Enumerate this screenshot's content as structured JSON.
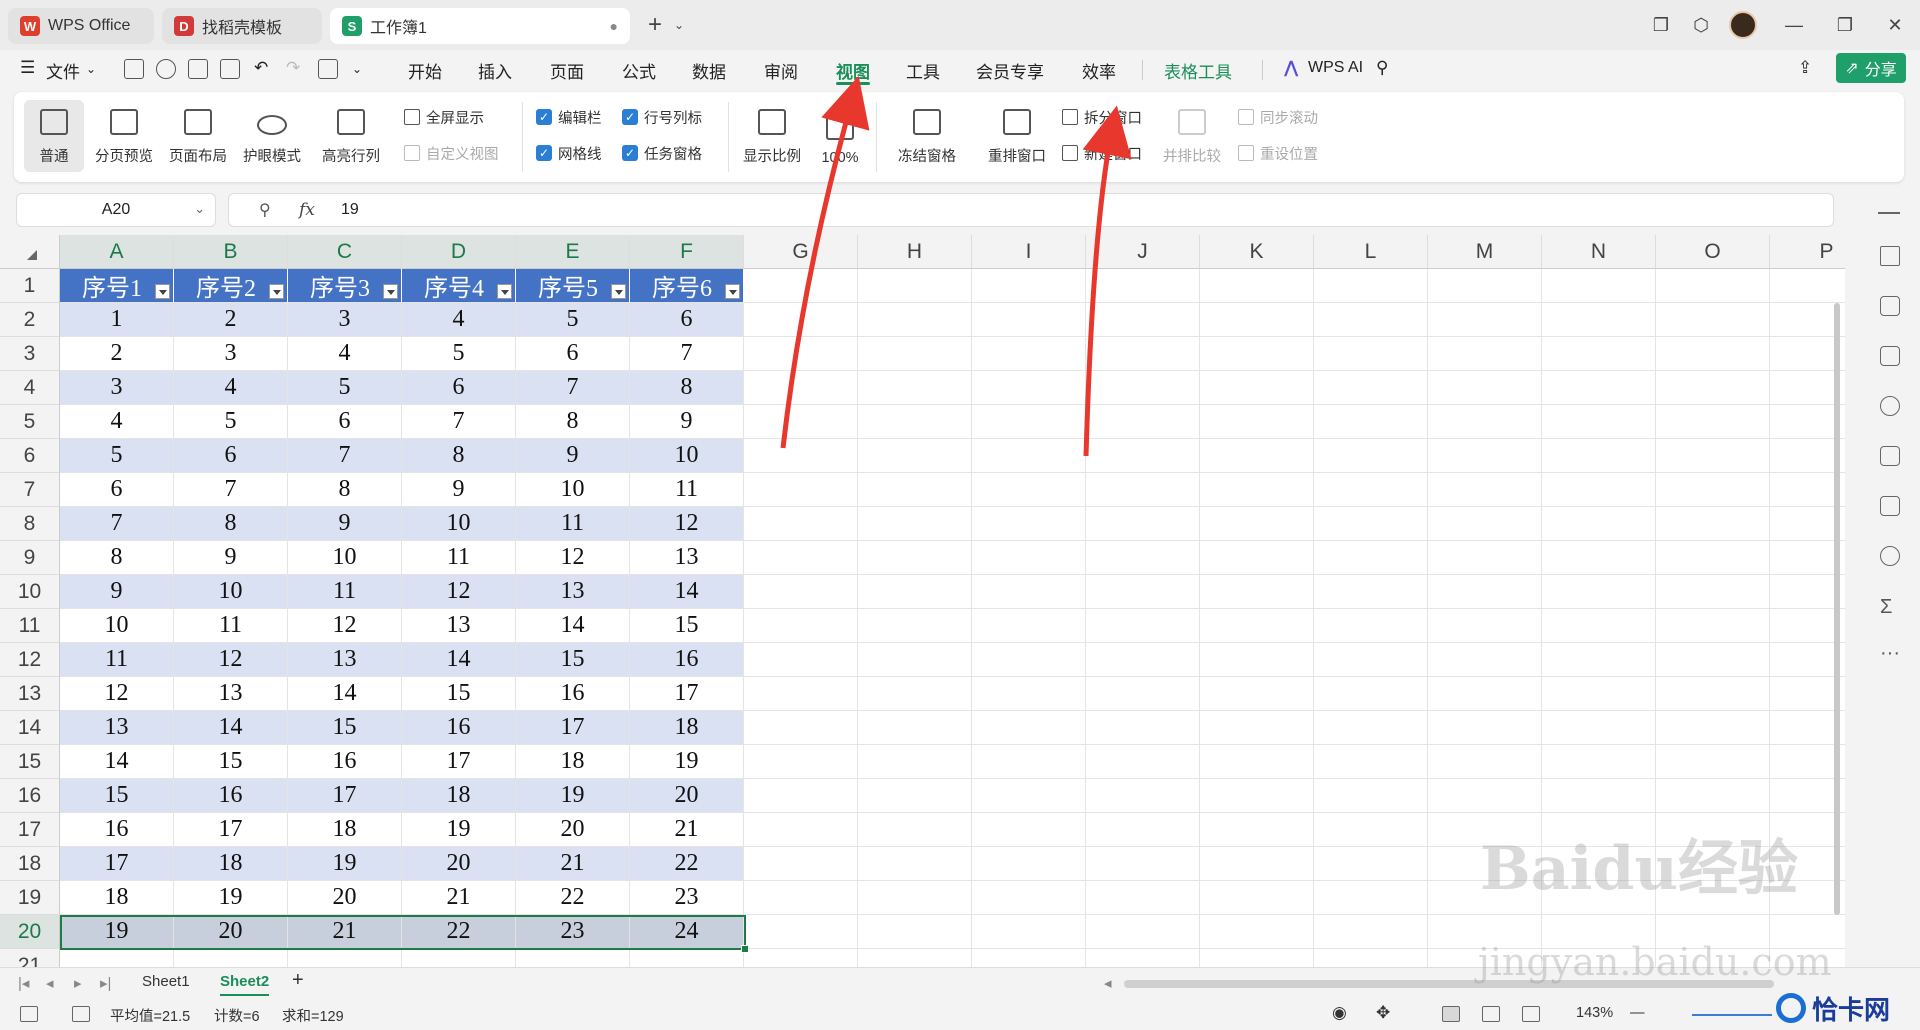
{
  "tabs": [
    {
      "label": "WPS Office",
      "logo": "W",
      "color": "#e03e2d"
    },
    {
      "label": "找稻壳模板",
      "logo": "D",
      "color": "#d23a3a"
    },
    {
      "label": "工作簿1",
      "logo": "S",
      "color": "#1f9f6a",
      "active": true
    }
  ],
  "menu": {
    "file": "文件",
    "items": [
      "开始",
      "插入",
      "页面",
      "公式",
      "数据",
      "审阅",
      "视图",
      "工具",
      "会员专享",
      "效率"
    ],
    "active_item": "视图",
    "table_tools": "表格工具",
    "wps_ai": "WPS AI",
    "share": "分享"
  },
  "ribbon": {
    "view_normal": "普通",
    "page_break_preview": "分页预览",
    "page_layout": "页面布局",
    "eye_protection": "护眼模式",
    "highlight_rowcol": "高亮行列",
    "fullscreen": "全屏显示",
    "custom_view": "自定义视图",
    "formula_bar_chk": "编辑栏",
    "row_col_header_chk": "行号列标",
    "gridlines_chk": "网格线",
    "task_pane_chk": "任务窗格",
    "zoom_ratio": "显示比例",
    "zoom_100": "100%",
    "freeze_panes": "冻结窗格",
    "arrange_windows": "重排窗口",
    "split_window": "拆分窗口",
    "new_window": "新建窗口",
    "side_by_side": "并排比较",
    "sync_scroll": "同步滚动",
    "reset_position": "重设位置"
  },
  "formula": {
    "name_box": "A20",
    "fx": "fx",
    "value": "19"
  },
  "columns": [
    "A",
    "B",
    "C",
    "D",
    "E",
    "F",
    "G",
    "H",
    "I",
    "J",
    "K",
    "L",
    "M",
    "N",
    "O",
    "P"
  ],
  "table": {
    "headers": [
      "序号1",
      "序号2",
      "序号3",
      "序号4",
      "序号5",
      "序号6"
    ],
    "rows": [
      [
        1,
        2,
        3,
        4,
        5,
        6
      ],
      [
        2,
        3,
        4,
        5,
        6,
        7
      ],
      [
        3,
        4,
        5,
        6,
        7,
        8
      ],
      [
        4,
        5,
        6,
        7,
        8,
        9
      ],
      [
        5,
        6,
        7,
        8,
        9,
        10
      ],
      [
        6,
        7,
        8,
        9,
        10,
        11
      ],
      [
        7,
        8,
        9,
        10,
        11,
        12
      ],
      [
        8,
        9,
        10,
        11,
        12,
        13
      ],
      [
        9,
        10,
        11,
        12,
        13,
        14
      ],
      [
        10,
        11,
        12,
        13,
        14,
        15
      ],
      [
        11,
        12,
        13,
        14,
        15,
        16
      ],
      [
        12,
        13,
        14,
        15,
        16,
        17
      ],
      [
        13,
        14,
        15,
        16,
        17,
        18
      ],
      [
        14,
        15,
        16,
        17,
        18,
        19
      ],
      [
        15,
        16,
        17,
        18,
        19,
        20
      ],
      [
        16,
        17,
        18,
        19,
        20,
        21
      ],
      [
        17,
        18,
        19,
        20,
        21,
        22
      ],
      [
        18,
        19,
        20,
        21,
        22,
        23
      ],
      [
        19,
        20,
        21,
        22,
        23,
        24
      ]
    ],
    "selected_row": 20
  },
  "row_numbers": [
    "1",
    "2",
    "3",
    "4",
    "5",
    "6",
    "7",
    "8",
    "9",
    "10",
    "11",
    "12",
    "13",
    "14",
    "15",
    "16",
    "17",
    "18",
    "19",
    "20",
    "21"
  ],
  "sheets": [
    "Sheet1",
    "Sheet2"
  ],
  "active_sheet": "Sheet2",
  "status": {
    "average": "平均值=21.5",
    "count": "计数=6",
    "sum": "求和=129",
    "zoom": "143%"
  },
  "watermark": {
    "main": "Baidu经验",
    "sub": "jingyan.baidu.com",
    "corner": "恰卡网"
  },
  "colors": {
    "accent": "#1b8f5a",
    "table_header": "#4472c4",
    "table_band": "#d9e1f2",
    "selection": "#1e7b45",
    "annotation_arrow": "#e8372c"
  }
}
